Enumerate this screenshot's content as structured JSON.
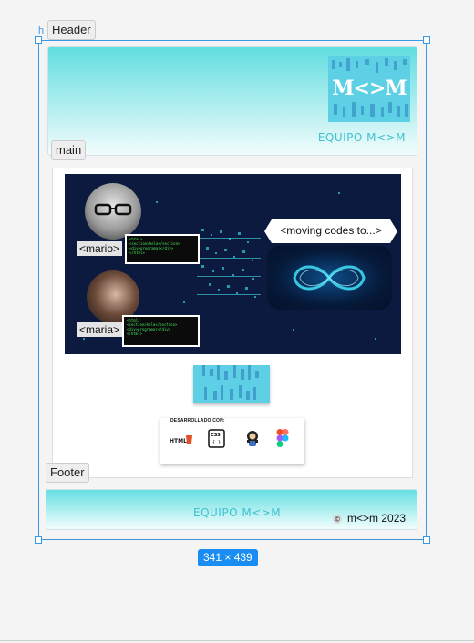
{
  "frame_labels": {
    "header": "Header",
    "main": "main",
    "footer": "Footer",
    "artboard_hint": "h"
  },
  "header": {
    "logo_text": "M<>M",
    "team_name": "EQUIPO M<>M"
  },
  "hero": {
    "bubble_text": "<moving codes to...>",
    "person1_label": "<mario>",
    "person2_label": "<maria>",
    "code_lines": [
      "<html>",
      "<section>hola</section>",
      "<div>programar</div>",
      "</html>"
    ]
  },
  "devcard": {
    "title": "DESARROLLADO CON:",
    "tools": [
      "html5-icon",
      "css3-icon",
      "github-icon",
      "figma-icon"
    ],
    "html_label": "HTML",
    "css_label": "CSS"
  },
  "footer": {
    "team_name": "EQUIPO M<>M",
    "copyright_symbol": "©",
    "copyright_text": "m<>m 2023"
  },
  "selection": {
    "dimensions": "341 × 439"
  },
  "colors": {
    "accent": "#3b99e3",
    "teal": "#5ed0e6",
    "hero_bg": "#0b1a3e",
    "badge": "#1a8df2"
  }
}
